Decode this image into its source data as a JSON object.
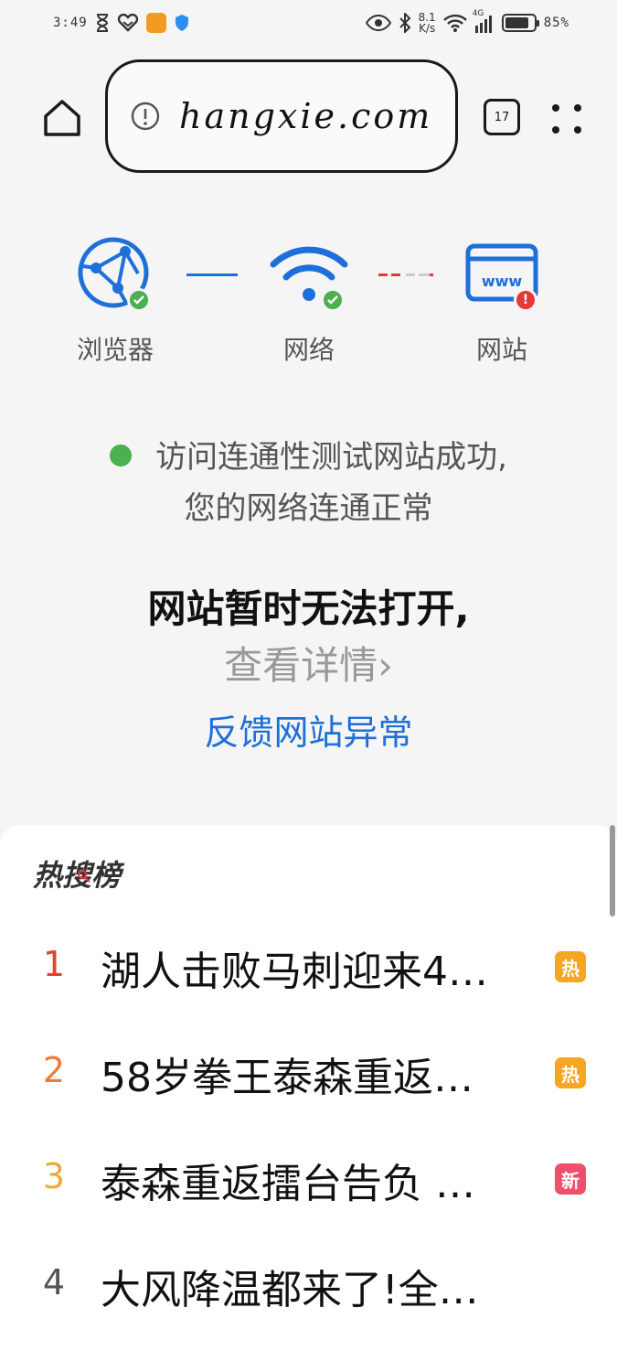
{
  "status_bar": {
    "time": "3:49",
    "speed_value": "8.1",
    "speed_unit": "K/s",
    "network_type": "4G",
    "battery_percent": "85%",
    "battery_level": 0.85
  },
  "toolbar": {
    "url": "hangxie.com",
    "tab_count": "17"
  },
  "diagnostics": {
    "browser_label": "浏览器",
    "network_label": "网络",
    "website_label": "网站",
    "www_text": "www",
    "error_mark": "!"
  },
  "messages": {
    "test_line1": "访问连通性测试网站成功,",
    "test_line2": "您的网络连通正常",
    "error_title": "网站暂时无法打开,",
    "details_link": "查看详情",
    "details_chevron": "›",
    "feedback_link": "反馈网站异常"
  },
  "hot_search": {
    "title": "热搜榜",
    "items": [
      {
        "rank": "1",
        "text": "湖人击败马刺迎来4…",
        "tag": "热",
        "rank_color": "#e0442f",
        "tag_color": "#f5a623"
      },
      {
        "rank": "2",
        "text": "58岁拳王泰森重返…",
        "tag": "热",
        "rank_color": "#ee7a34",
        "tag_color": "#f5a623"
      },
      {
        "rank": "3",
        "text": "泰森重返擂台告负 …",
        "tag": "新",
        "rank_color": "#f0a93a",
        "tag_color": "#ef4f6c"
      },
      {
        "rank": "4",
        "text": "大风降温都来了!全…",
        "tag": "",
        "rank_color": "#555555",
        "tag_color": ""
      }
    ]
  },
  "colors": {
    "accent_blue": "#1e6fd9",
    "ok_green": "#4caf50",
    "error_red": "#e53935"
  }
}
